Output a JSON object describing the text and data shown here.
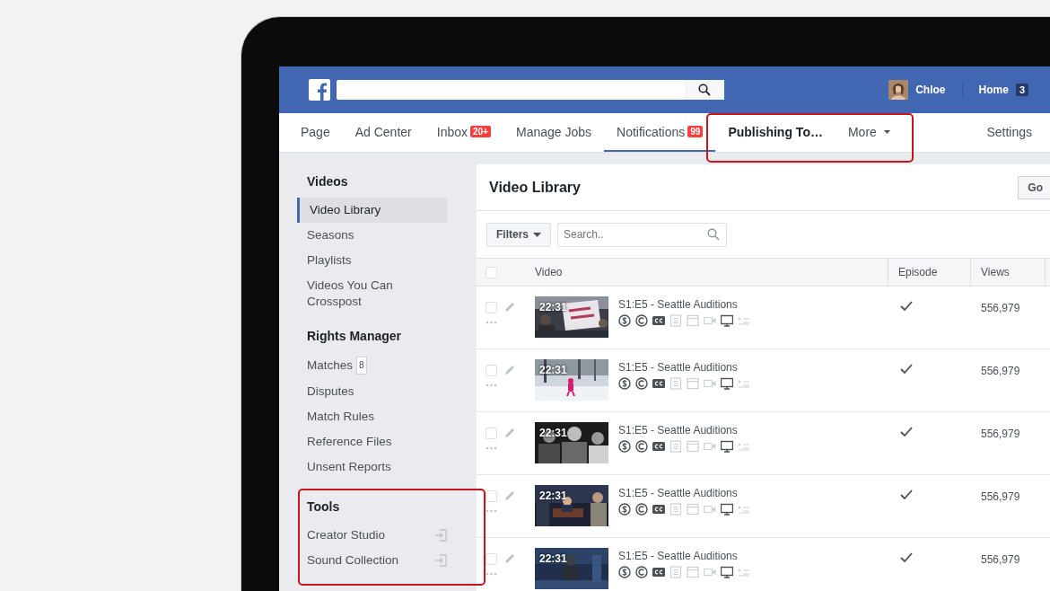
{
  "top_bar": {
    "user": {
      "name": "Chloe"
    },
    "home": {
      "label": "Home",
      "count": "3"
    }
  },
  "nav": {
    "tabs": [
      {
        "label": "Page",
        "selected": false,
        "emphasized": false
      },
      {
        "label": "Ad Center",
        "selected": false,
        "emphasized": false
      },
      {
        "label": "Inbox",
        "badge": "20+",
        "selected": false,
        "emphasized": false
      },
      {
        "label": "Manage Jobs",
        "selected": false,
        "emphasized": false
      },
      {
        "label": "Notifications",
        "badge": "99",
        "selected": true,
        "emphasized": false
      },
      {
        "label": "Publishing To…",
        "selected": false,
        "emphasized": true,
        "highlighted": true
      },
      {
        "label": "More",
        "kind": "menu",
        "selected": false,
        "emphasized": false,
        "highlighted": true
      },
      {
        "label": "Settings",
        "selected": false,
        "emphasized": false
      }
    ]
  },
  "sidebar": {
    "sections": [
      {
        "title": "Videos",
        "items": [
          {
            "label": "Video Library",
            "selected": true
          },
          {
            "label": "Seasons",
            "selected": false
          },
          {
            "label": "Playlists",
            "selected": false
          },
          {
            "label": "Videos You Can Crosspost",
            "selected": false
          }
        ]
      },
      {
        "title": "Rights Manager",
        "items": [
          {
            "label": "Matches",
            "badge": "8",
            "selected": false
          },
          {
            "label": "Disputes",
            "selected": false
          },
          {
            "label": "Match Rules",
            "selected": false
          },
          {
            "label": "Reference Files",
            "selected": false
          },
          {
            "label": "Unsent Reports",
            "selected": false
          }
        ]
      },
      {
        "title": "Tools",
        "highlighted": true,
        "items": [
          {
            "label": "Creator Studio",
            "kind": "external",
            "selected": false
          },
          {
            "label": "Sound Collection",
            "kind": "external",
            "selected": false
          }
        ]
      }
    ]
  },
  "library": {
    "title": "Video Library",
    "go_button": "Go",
    "filters_button": "Filters",
    "search": {
      "placeholder": "Search.."
    },
    "columns": [
      "Video",
      "Episode",
      "Views"
    ],
    "all_checked": false,
    "rows": [
      {
        "duration": "22:31",
        "title": "S1:E5 - Seattle Auditions",
        "episode": true,
        "views": "556,979",
        "checked": false,
        "icons": [
          {
            "kind": "dollar",
            "active": true
          },
          {
            "kind": "copyright",
            "active": true
          },
          {
            "kind": "cc",
            "active": true
          },
          {
            "kind": "doc",
            "active": false
          },
          {
            "kind": "window",
            "active": false
          },
          {
            "kind": "camera",
            "active": false
          },
          {
            "kind": "monitor",
            "active": true
          },
          {
            "kind": "list",
            "active": false
          }
        ]
      },
      {
        "duration": "22:31",
        "title": "S1:E5 - Seattle Auditions",
        "episode": true,
        "views": "556,979",
        "checked": false,
        "icons": [
          {
            "kind": "dollar",
            "active": true
          },
          {
            "kind": "copyright",
            "active": true
          },
          {
            "kind": "cc",
            "active": true
          },
          {
            "kind": "doc",
            "active": false
          },
          {
            "kind": "window",
            "active": false
          },
          {
            "kind": "camera",
            "active": false
          },
          {
            "kind": "monitor",
            "active": true
          },
          {
            "kind": "list",
            "active": false
          }
        ]
      },
      {
        "duration": "22:31",
        "title": "S1:E5 - Seattle Auditions",
        "episode": true,
        "views": "556,979",
        "checked": false,
        "icons": [
          {
            "kind": "dollar",
            "active": true
          },
          {
            "kind": "copyright",
            "active": true
          },
          {
            "kind": "cc",
            "active": true
          },
          {
            "kind": "doc",
            "active": false
          },
          {
            "kind": "window",
            "active": false
          },
          {
            "kind": "camera",
            "active": false
          },
          {
            "kind": "monitor",
            "active": true
          },
          {
            "kind": "list",
            "active": false
          }
        ]
      },
      {
        "duration": "22:31",
        "title": "S1:E5 - Seattle Auditions",
        "episode": true,
        "views": "556,979",
        "checked": false,
        "icons": [
          {
            "kind": "dollar",
            "active": true
          },
          {
            "kind": "copyright",
            "active": true
          },
          {
            "kind": "cc",
            "active": true
          },
          {
            "kind": "doc",
            "active": false
          },
          {
            "kind": "window",
            "active": false
          },
          {
            "kind": "camera",
            "active": false
          },
          {
            "kind": "monitor",
            "active": true
          },
          {
            "kind": "list",
            "active": false
          }
        ]
      },
      {
        "duration": "22:31",
        "title": "S1:E5 - Seattle Auditions",
        "episode": true,
        "views": "556,979",
        "checked": false,
        "icons": [
          {
            "kind": "dollar",
            "active": true
          },
          {
            "kind": "copyright",
            "active": true
          },
          {
            "kind": "cc",
            "active": true
          },
          {
            "kind": "doc",
            "active": false
          },
          {
            "kind": "window",
            "active": false
          },
          {
            "kind": "camera",
            "active": false
          },
          {
            "kind": "monitor",
            "active": true
          },
          {
            "kind": "list",
            "active": false
          }
        ]
      }
    ]
  }
}
